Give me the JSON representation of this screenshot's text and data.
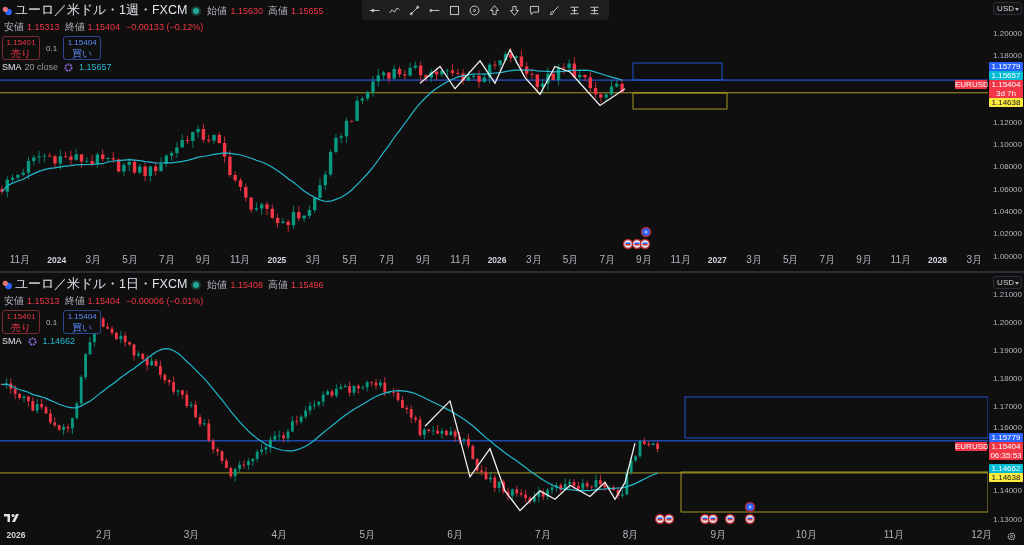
{
  "charts": [
    {
      "title": "ユーロ／米ドル・1週・FXCM",
      "market_open": true,
      "ohlc": [
        {
          "label": "始値",
          "value": "1.15630"
        },
        {
          "label": "高値",
          "value": "1.15655"
        },
        {
          "label": "安値",
          "value": "1.15313"
        },
        {
          "label": "終値",
          "value": "1.15404"
        }
      ],
      "change": "−0.00133 (−0.12%)",
      "sell": {
        "price": "1.15401",
        "label": "売り"
      },
      "spread": "0.1",
      "buy": {
        "price": "1.15404",
        "label": "買い"
      },
      "indicator": {
        "name": "SMA",
        "params": "20 close",
        "value": "1.15657"
      },
      "currency": "USD",
      "price_ticks": [
        "1.20000",
        "1.18000",
        "1.12000",
        "1.10000",
        "1.08000",
        "1.06000",
        "1.04000",
        "1.02000",
        "1.00000"
      ],
      "time_ticks": [
        {
          "label": "11月",
          "kind": "month"
        },
        {
          "label": "2024",
          "kind": "year"
        },
        {
          "label": "3月",
          "kind": "month"
        },
        {
          "label": "5月",
          "kind": "month"
        },
        {
          "label": "7月",
          "kind": "month"
        },
        {
          "label": "9月",
          "kind": "month"
        },
        {
          "label": "11月",
          "kind": "month"
        },
        {
          "label": "2025",
          "kind": "year"
        },
        {
          "label": "3月",
          "kind": "month"
        },
        {
          "label": "5月",
          "kind": "month"
        },
        {
          "label": "7月",
          "kind": "month"
        },
        {
          "label": "9月",
          "kind": "month"
        },
        {
          "label": "11月",
          "kind": "month"
        },
        {
          "label": "2026",
          "kind": "year"
        },
        {
          "label": "3月",
          "kind": "month"
        },
        {
          "label": "5月",
          "kind": "month"
        },
        {
          "label": "7月",
          "kind": "month"
        },
        {
          "label": "9月",
          "kind": "month"
        },
        {
          "label": "11月",
          "kind": "month"
        },
        {
          "label": "2027",
          "kind": "year"
        },
        {
          "label": "3月",
          "kind": "month"
        },
        {
          "label": "5月",
          "kind": "month"
        },
        {
          "label": "7月",
          "kind": "month"
        },
        {
          "label": "9月",
          "kind": "month"
        },
        {
          "label": "11月",
          "kind": "month"
        },
        {
          "label": "2028",
          "kind": "year"
        },
        {
          "label": "3月",
          "kind": "month"
        }
      ],
      "symbol_tag": "EURUSD",
      "price_tags": [
        {
          "kind": "level",
          "value": "1.15779",
          "color": "#2962ff"
        },
        {
          "kind": "indicator",
          "value": "1.15657",
          "color": "#00bcd4"
        },
        {
          "kind": "last",
          "value": "1.15404",
          "countdown": "3d 7h",
          "color": "#f23645"
        },
        {
          "kind": "level",
          "value": "1.14638",
          "color": "#ffeb3b"
        }
      ]
    },
    {
      "title": "ユーロ／米ドル・1日・FXCM",
      "market_open": true,
      "ohlc": [
        {
          "label": "始値",
          "value": "1.15408"
        },
        {
          "label": "高値",
          "value": "1.15496"
        },
        {
          "label": "安値",
          "value": "1.15313"
        },
        {
          "label": "終値",
          "value": "1.15404"
        }
      ],
      "change": "−0.00006 (−0.01%)",
      "sell": {
        "price": "1.15401",
        "label": "売り"
      },
      "spread": "0.1",
      "buy": {
        "price": "1.15404",
        "label": "買い"
      },
      "indicator": {
        "name": "SMA",
        "value": "1.14662"
      },
      "currency": "USD",
      "price_ticks": [
        "1.21000",
        "1.20000",
        "1.19000",
        "1.18000",
        "1.17000",
        "1.16000",
        "1.14000",
        "1.13000"
      ],
      "time_ticks": [
        {
          "label": "2026",
          "kind": "year"
        },
        {
          "label": "2月",
          "kind": "month"
        },
        {
          "label": "3月",
          "kind": "month"
        },
        {
          "label": "4月",
          "kind": "month"
        },
        {
          "label": "5月",
          "kind": "month"
        },
        {
          "label": "6月",
          "kind": "month"
        },
        {
          "label": "7月",
          "kind": "month"
        },
        {
          "label": "8月",
          "kind": "month"
        },
        {
          "label": "9月",
          "kind": "month"
        },
        {
          "label": "10月",
          "kind": "month"
        },
        {
          "label": "11月",
          "kind": "month"
        },
        {
          "label": "12月",
          "kind": "month"
        }
      ],
      "symbol_tag": "EURUSD",
      "price_tags": [
        {
          "kind": "level",
          "value": "1.15779",
          "color": "#2962ff"
        },
        {
          "kind": "last",
          "value": "1.15404",
          "countdown": "06:35:53",
          "color": "#f23645"
        },
        {
          "kind": "indicator",
          "value": "1.14662",
          "color": "#00bcd4"
        },
        {
          "kind": "level",
          "value": "1.14638",
          "color": "#ffeb3b"
        }
      ]
    }
  ]
}
